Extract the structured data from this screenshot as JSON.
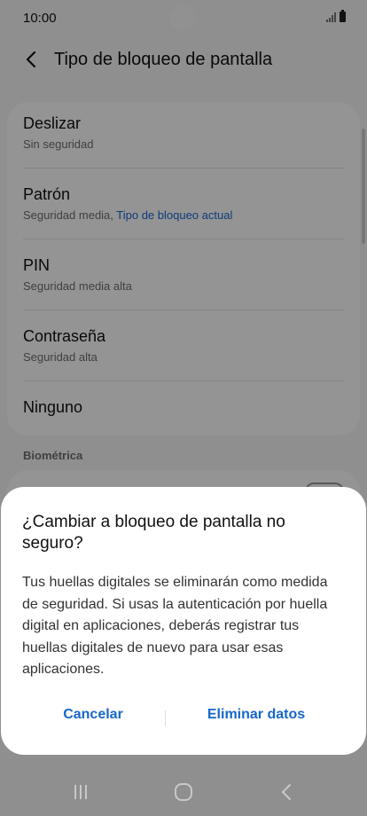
{
  "status_bar": {
    "time": "10:00"
  },
  "header": {
    "back_icon": "chevron-left-icon",
    "title": "Tipo de bloqueo de pantalla"
  },
  "options": [
    {
      "title": "Deslizar",
      "subtitle": "Sin seguridad",
      "subtitle_accent": ""
    },
    {
      "title": "Patrón",
      "subtitle": "Seguridad media, ",
      "subtitle_accent": "Tipo de bloqueo actual"
    },
    {
      "title": "PIN",
      "subtitle": "Seguridad media alta",
      "subtitle_accent": ""
    },
    {
      "title": "Contraseña",
      "subtitle": "Seguridad alta",
      "subtitle_accent": ""
    },
    {
      "title": "Ninguno",
      "subtitle": "",
      "subtitle_accent": ""
    }
  ],
  "biometric_section": {
    "label": "Biométrica"
  },
  "dialog": {
    "title": "¿Cambiar a bloqueo de pantalla no seguro?",
    "message": "Tus huellas digitales se eliminarán como medida de seguridad. Si usas la autenticación por huella digital en aplicaciones, deberás registrar tus huellas digitales de nuevo para usar esas aplicaciones.",
    "cancel_label": "Cancelar",
    "confirm_label": "Eliminar datos"
  },
  "colors": {
    "accent": "#1767c9",
    "link": "#1967d2",
    "background": "#f6f6f6",
    "card": "#ffffff"
  },
  "nav_bar": {
    "recent_icon": "recent-apps-icon",
    "home_icon": "home-icon",
    "back_icon": "back-icon"
  }
}
